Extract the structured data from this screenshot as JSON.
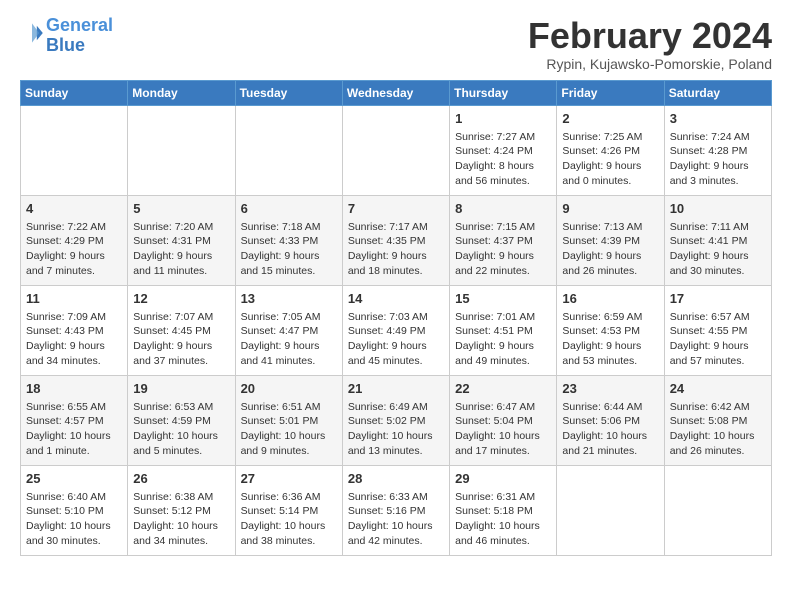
{
  "logo": {
    "line1": "General",
    "line2": "Blue"
  },
  "title": "February 2024",
  "subtitle": "Rypin, Kujawsko-Pomorskie, Poland",
  "headers": [
    "Sunday",
    "Monday",
    "Tuesday",
    "Wednesday",
    "Thursday",
    "Friday",
    "Saturday"
  ],
  "weeks": [
    [
      {
        "day": "",
        "info": ""
      },
      {
        "day": "",
        "info": ""
      },
      {
        "day": "",
        "info": ""
      },
      {
        "day": "",
        "info": ""
      },
      {
        "day": "1",
        "info": "Sunrise: 7:27 AM\nSunset: 4:24 PM\nDaylight: 8 hours\nand 56 minutes."
      },
      {
        "day": "2",
        "info": "Sunrise: 7:25 AM\nSunset: 4:26 PM\nDaylight: 9 hours\nand 0 minutes."
      },
      {
        "day": "3",
        "info": "Sunrise: 7:24 AM\nSunset: 4:28 PM\nDaylight: 9 hours\nand 3 minutes."
      }
    ],
    [
      {
        "day": "4",
        "info": "Sunrise: 7:22 AM\nSunset: 4:29 PM\nDaylight: 9 hours\nand 7 minutes."
      },
      {
        "day": "5",
        "info": "Sunrise: 7:20 AM\nSunset: 4:31 PM\nDaylight: 9 hours\nand 11 minutes."
      },
      {
        "day": "6",
        "info": "Sunrise: 7:18 AM\nSunset: 4:33 PM\nDaylight: 9 hours\nand 15 minutes."
      },
      {
        "day": "7",
        "info": "Sunrise: 7:17 AM\nSunset: 4:35 PM\nDaylight: 9 hours\nand 18 minutes."
      },
      {
        "day": "8",
        "info": "Sunrise: 7:15 AM\nSunset: 4:37 PM\nDaylight: 9 hours\nand 22 minutes."
      },
      {
        "day": "9",
        "info": "Sunrise: 7:13 AM\nSunset: 4:39 PM\nDaylight: 9 hours\nand 26 minutes."
      },
      {
        "day": "10",
        "info": "Sunrise: 7:11 AM\nSunset: 4:41 PM\nDaylight: 9 hours\nand 30 minutes."
      }
    ],
    [
      {
        "day": "11",
        "info": "Sunrise: 7:09 AM\nSunset: 4:43 PM\nDaylight: 9 hours\nand 34 minutes."
      },
      {
        "day": "12",
        "info": "Sunrise: 7:07 AM\nSunset: 4:45 PM\nDaylight: 9 hours\nand 37 minutes."
      },
      {
        "day": "13",
        "info": "Sunrise: 7:05 AM\nSunset: 4:47 PM\nDaylight: 9 hours\nand 41 minutes."
      },
      {
        "day": "14",
        "info": "Sunrise: 7:03 AM\nSunset: 4:49 PM\nDaylight: 9 hours\nand 45 minutes."
      },
      {
        "day": "15",
        "info": "Sunrise: 7:01 AM\nSunset: 4:51 PM\nDaylight: 9 hours\nand 49 minutes."
      },
      {
        "day": "16",
        "info": "Sunrise: 6:59 AM\nSunset: 4:53 PM\nDaylight: 9 hours\nand 53 minutes."
      },
      {
        "day": "17",
        "info": "Sunrise: 6:57 AM\nSunset: 4:55 PM\nDaylight: 9 hours\nand 57 minutes."
      }
    ],
    [
      {
        "day": "18",
        "info": "Sunrise: 6:55 AM\nSunset: 4:57 PM\nDaylight: 10 hours\nand 1 minute."
      },
      {
        "day": "19",
        "info": "Sunrise: 6:53 AM\nSunset: 4:59 PM\nDaylight: 10 hours\nand 5 minutes."
      },
      {
        "day": "20",
        "info": "Sunrise: 6:51 AM\nSunset: 5:01 PM\nDaylight: 10 hours\nand 9 minutes."
      },
      {
        "day": "21",
        "info": "Sunrise: 6:49 AM\nSunset: 5:02 PM\nDaylight: 10 hours\nand 13 minutes."
      },
      {
        "day": "22",
        "info": "Sunrise: 6:47 AM\nSunset: 5:04 PM\nDaylight: 10 hours\nand 17 minutes."
      },
      {
        "day": "23",
        "info": "Sunrise: 6:44 AM\nSunset: 5:06 PM\nDaylight: 10 hours\nand 21 minutes."
      },
      {
        "day": "24",
        "info": "Sunrise: 6:42 AM\nSunset: 5:08 PM\nDaylight: 10 hours\nand 26 minutes."
      }
    ],
    [
      {
        "day": "25",
        "info": "Sunrise: 6:40 AM\nSunset: 5:10 PM\nDaylight: 10 hours\nand 30 minutes."
      },
      {
        "day": "26",
        "info": "Sunrise: 6:38 AM\nSunset: 5:12 PM\nDaylight: 10 hours\nand 34 minutes."
      },
      {
        "day": "27",
        "info": "Sunrise: 6:36 AM\nSunset: 5:14 PM\nDaylight: 10 hours\nand 38 minutes."
      },
      {
        "day": "28",
        "info": "Sunrise: 6:33 AM\nSunset: 5:16 PM\nDaylight: 10 hours\nand 42 minutes."
      },
      {
        "day": "29",
        "info": "Sunrise: 6:31 AM\nSunset: 5:18 PM\nDaylight: 10 hours\nand 46 minutes."
      },
      {
        "day": "",
        "info": ""
      },
      {
        "day": "",
        "info": ""
      }
    ]
  ]
}
